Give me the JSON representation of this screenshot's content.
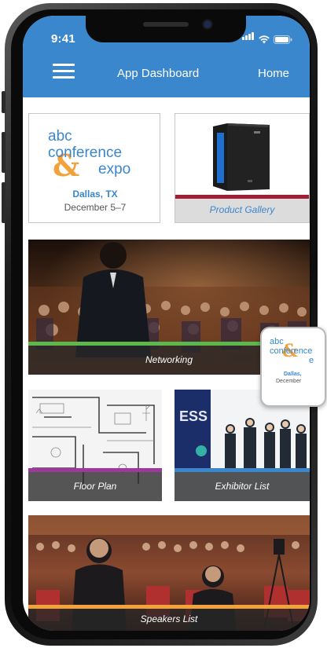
{
  "status": {
    "time": "9:41"
  },
  "nav": {
    "title": "App Dashboard",
    "home": "Home"
  },
  "tiles": {
    "event": {
      "logo_line1": "abc",
      "logo_line2": "conference",
      "logo_line3": "expo",
      "logo_amp": "&",
      "city": "Dallas, TX",
      "dates": "December 5–7"
    },
    "gallery": {
      "label": "Product Gallery"
    },
    "networking": {
      "label": "Networking"
    },
    "floorplan": {
      "label": "Floor Plan"
    },
    "exhibitors": {
      "label": "Exhibitor List"
    },
    "speakers": {
      "label": "Speakers List"
    }
  },
  "floating_card": {
    "logo_line1": "abc",
    "logo_line2": "conference",
    "logo_line3": "e",
    "logo_amp": "&",
    "city": "Dallas,",
    "dates": "December"
  },
  "colors": {
    "brand_blue": "#3a87cd",
    "accent_orange": "#f2a23a",
    "gallery_red": "#a01e35",
    "networking_green": "#5cb84a",
    "floorplan_purple": "#9b3a9b",
    "exhibitor_blue": "#3a87cd",
    "speakers_orange": "#f2a23a"
  }
}
